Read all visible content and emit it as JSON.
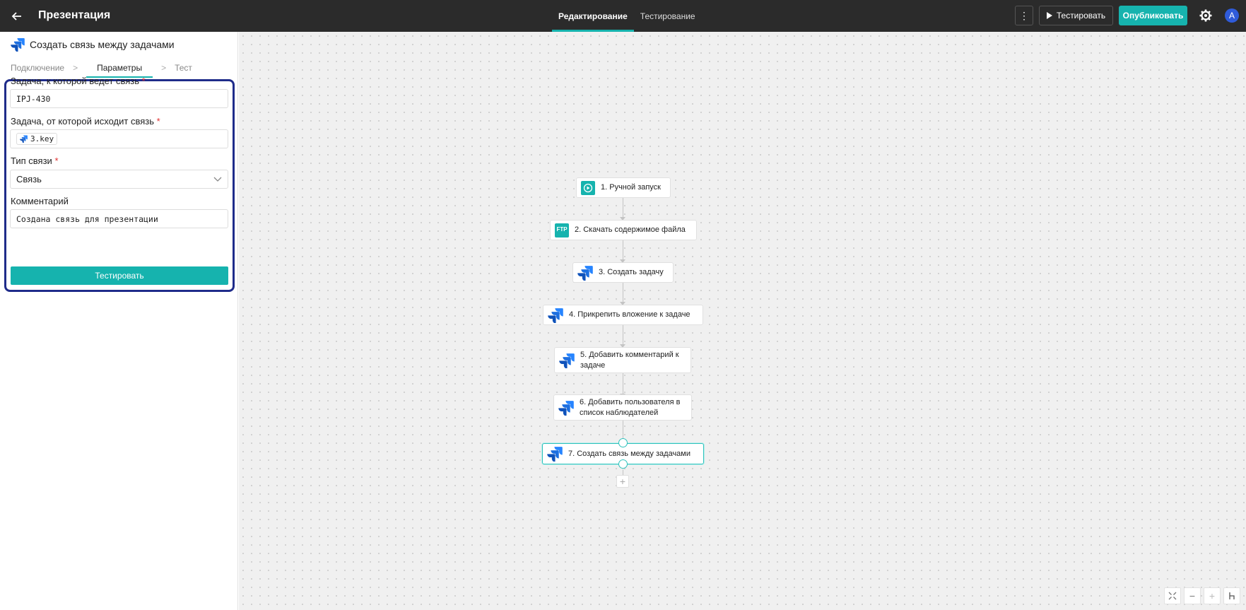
{
  "app": {
    "title": "Презентация"
  },
  "center_tabs": [
    {
      "label": "Редактирование",
      "active": true
    },
    {
      "label": "Тестирование",
      "active": false
    }
  ],
  "toolbar": {
    "more_label": "⋮",
    "test_label": "Тестировать",
    "publish_label": "Опубликовать",
    "avatar_letter": "A"
  },
  "colors": {
    "accent": "#16b3ae",
    "topbar": "#2b2b2b",
    "highlight_border": "#1f2c8a",
    "avatar": "#2f5bd9"
  },
  "panel": {
    "title": "Создать связь между задачами",
    "steps": [
      "Подключение",
      "Параметры",
      "Тест"
    ],
    "active_step": "Параметры",
    "fields": {
      "target_label": "Задача, к которой ведет связь",
      "target_value": "IPJ-430",
      "source_label": "Задача, от которой исходит связь",
      "source_chip": "3.key",
      "type_label": "Тип связи",
      "type_value": "Связь",
      "comment_label": "Комментарий",
      "comment_value": "Создана связь для презентации"
    },
    "required_mark": "*",
    "run_button": "Тестировать"
  },
  "flow": {
    "nodes": [
      {
        "label": "1. Ручной запуск",
        "icon": "play-icon"
      },
      {
        "label": "2. Скачать содержимое файла",
        "icon": "ftp-icon",
        "icon_text": "FTP"
      },
      {
        "label": "3. Создать задачу",
        "icon": "jira-icon"
      },
      {
        "label": "4. Прикрепить вложение к задаче",
        "icon": "jira-icon"
      },
      {
        "label": "5. Добавить комментарий к задаче",
        "icon": "jira-icon"
      },
      {
        "label": "6. Добавить пользователя в список наблюдателей",
        "icon": "jira-icon"
      },
      {
        "label": "7. Создать связь между задачами",
        "icon": "jira-icon",
        "selected": true
      }
    ],
    "add_label": "+"
  },
  "zoom_controls": [
    "fit-view-icon",
    "zoom-out-icon",
    "zoom-in-icon",
    "layout-icon"
  ]
}
